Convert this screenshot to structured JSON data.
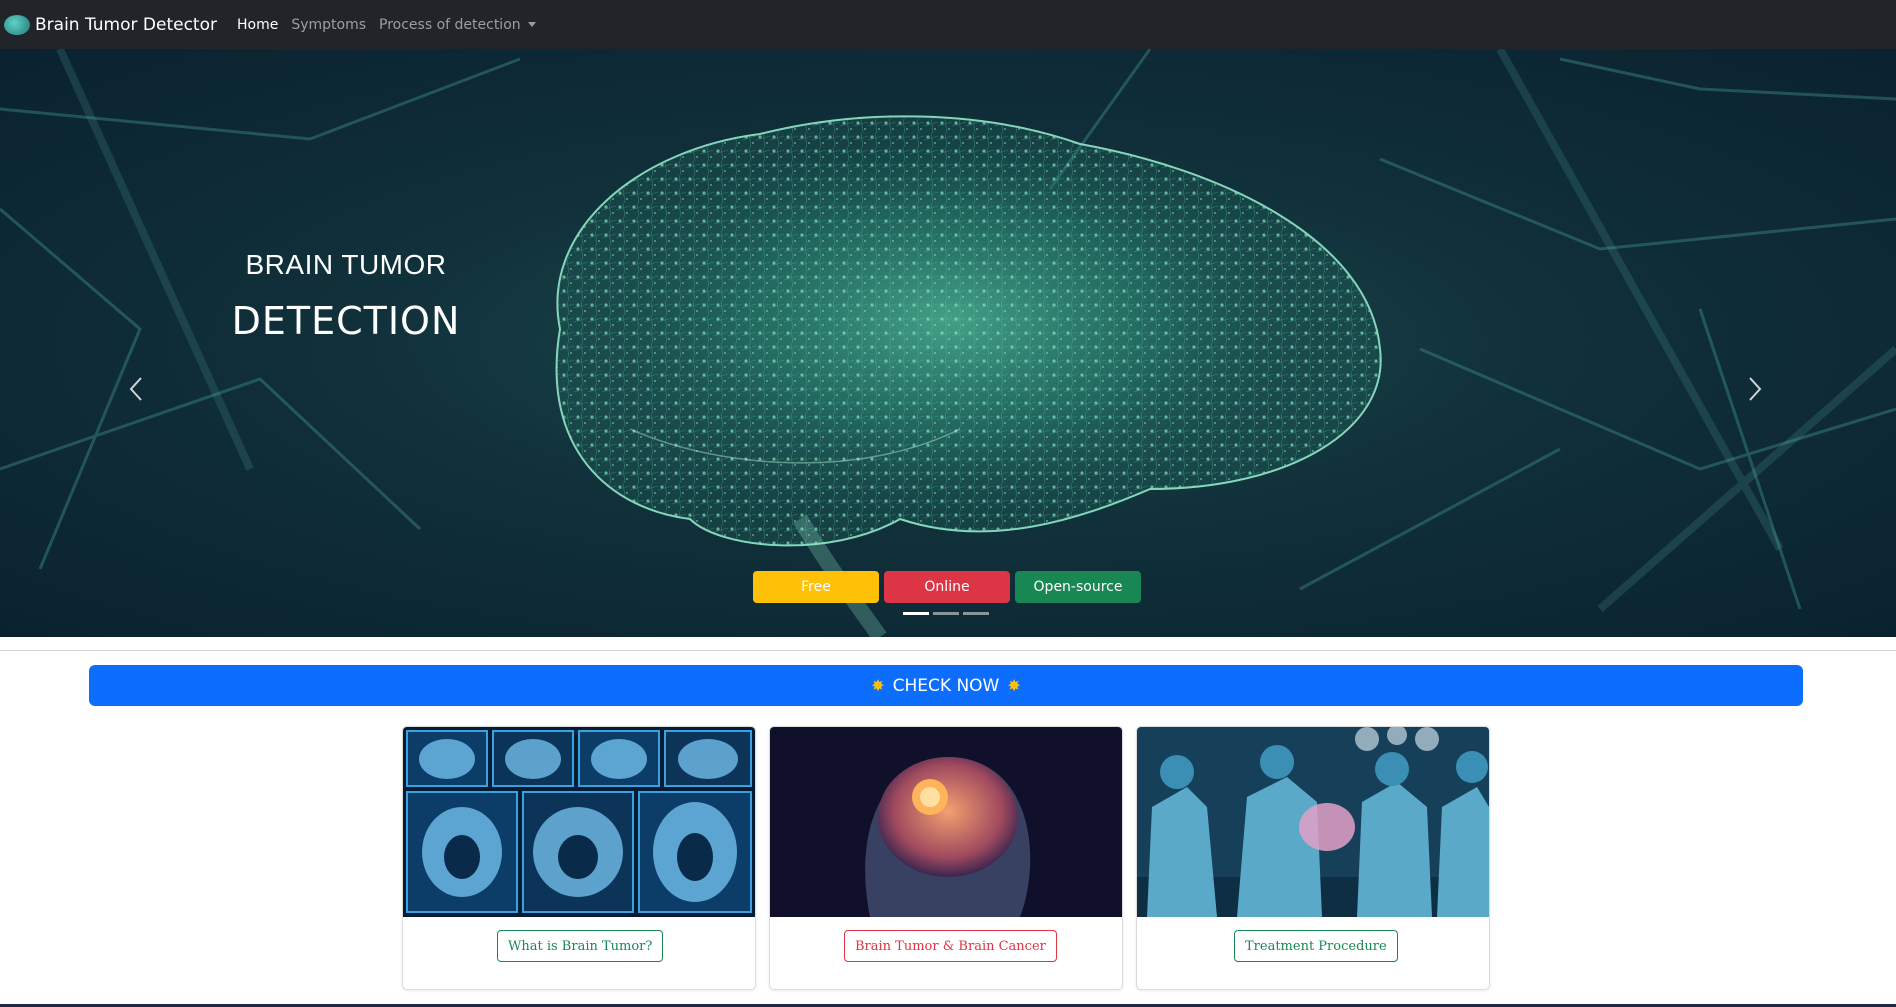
{
  "navbar": {
    "brand": "Brain Tumor Detector",
    "links": [
      {
        "label": "Home",
        "active": true
      },
      {
        "label": "Symptoms",
        "active": false
      },
      {
        "label": "Process of detection",
        "active": false,
        "dropdown": true
      }
    ]
  },
  "hero": {
    "title": "BRAIN TUMOR",
    "subtitle": "DETECTION",
    "tags": [
      "Free",
      "Online",
      "Open-source"
    ],
    "slide_count": 3,
    "active_slide": 1
  },
  "cta": {
    "label": "CHECK NOW",
    "star": "✸"
  },
  "cards": [
    {
      "button": "What is Brain Tumor?",
      "style": "green",
      "image": "mri-scans-image"
    },
    {
      "button": "Brain Tumor & Brain Cancer",
      "style": "red",
      "image": "brain-tumor-image"
    },
    {
      "button": "Treatment Procedure",
      "style": "green",
      "image": "surgery-image"
    }
  ],
  "colors": {
    "navbar": "#212529",
    "primary": "#0d6efd",
    "warning": "#ffc107",
    "danger": "#dc3545",
    "success": "#198754"
  }
}
